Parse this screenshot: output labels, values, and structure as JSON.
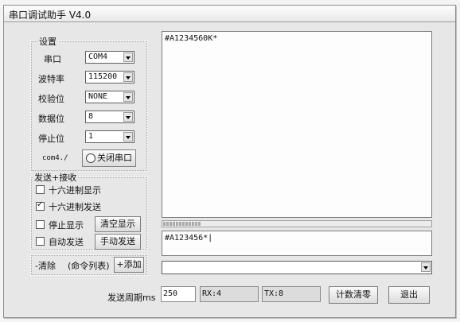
{
  "window": {
    "title": "串口调试助手 V4.0"
  },
  "settings": {
    "group_title": "设置",
    "rows": [
      {
        "label": "串口",
        "value": "COM4"
      },
      {
        "label": "波特率",
        "value": "115200"
      },
      {
        "label": "校验位",
        "value": "NONE"
      },
      {
        "label": "数据位",
        "value": "8"
      },
      {
        "label": "停止位",
        "value": "1"
      }
    ],
    "status_text": "com4./",
    "close_port_label": "关闭串口"
  },
  "sendrecv": {
    "group_title": "发送+接收",
    "hex_display": {
      "label": "十六进制显示",
      "checked": false
    },
    "hex_send": {
      "label": "十六进制发送",
      "checked": true,
      "mark": "✓"
    },
    "stop_display": {
      "label": "停止显示",
      "checked": false
    },
    "auto_send": {
      "label": "自动发送",
      "checked": false
    },
    "clear_display_label": "清空显示",
    "manual_send_label": "手动发送"
  },
  "command_list": {
    "remove_label": "-清除",
    "list_label": "(命令列表)",
    "add_label": "+添加"
  },
  "receive": {
    "text": "#A1234560K*"
  },
  "progress": {
    "fraction": 0.14
  },
  "send": {
    "text": "#A123456*|"
  },
  "bottom": {
    "period_label": "发送周期ms",
    "period_value": "250",
    "rx_label": "RX:4",
    "tx_label": "TX:8",
    "reset_count_label": "计数清零",
    "exit_label": "退出"
  }
}
